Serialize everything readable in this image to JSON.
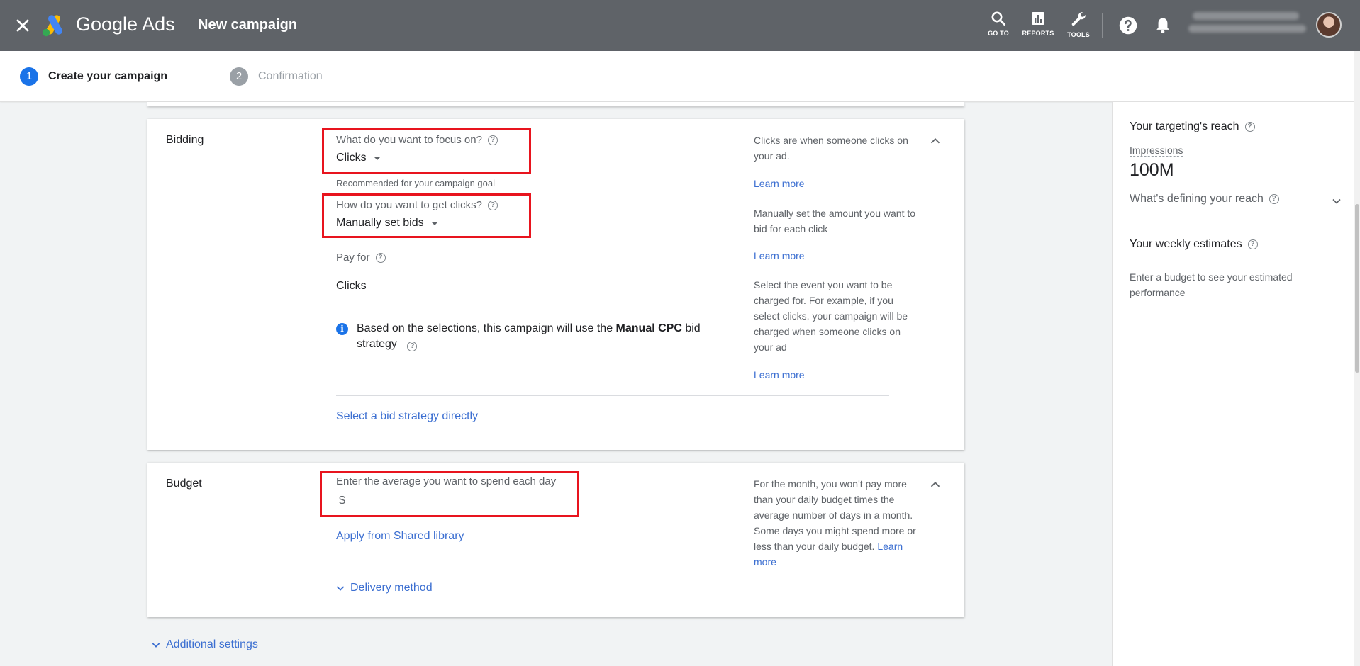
{
  "header": {
    "brand": "Google Ads",
    "title": "New campaign",
    "goto_label": "GO TO",
    "reports_label": "REPORTS",
    "tools_label": "TOOLS"
  },
  "stepper": {
    "steps": [
      {
        "num": "1",
        "label": "Create your campaign",
        "active": true
      },
      {
        "num": "2",
        "label": "Confirmation",
        "active": false
      }
    ]
  },
  "bidding": {
    "section_title": "Bidding",
    "focus_label": "What do you want to focus on?",
    "focus_value": "Clicks",
    "focus_hint": "Recommended for your campaign goal",
    "how_label": "How do you want to get clicks?",
    "how_value": "Manually set bids",
    "payfor_label": "Pay for",
    "payfor_value": "Clicks",
    "info_pre": "Based on the selections, this campaign will use the ",
    "info_bold": "Manual CPC",
    "info_post": " bid",
    "info_line2": "strategy",
    "select_strategy_link": "Select a bid strategy directly",
    "side_1": "Clicks are when someone clicks on your ad.",
    "side_2": "Manually set the amount you want to bid for each click",
    "side_3": "Select the event you want to be charged for. For example, if you select clicks, your campaign will be charged when someone clicks on your ad",
    "learn_more": "Learn more"
  },
  "budget": {
    "section_title": "Budget",
    "field_label": "Enter the average you want to spend each day",
    "currency": "$",
    "apply_link": "Apply from Shared library",
    "delivery_link": "Delivery method",
    "side_text": "For the month, you won't pay more than your daily budget times the average number of days in a month. Some days you might spend more or less than your daily budget.",
    "learn_more": "Learn more"
  },
  "additional_settings": "Additional settings",
  "right_panel": {
    "reach_title": "Your targeting's reach",
    "impressions_label": "Impressions",
    "impressions_value": "100M",
    "defining_label": "What's defining your reach",
    "weekly_title": "Your weekly estimates",
    "weekly_note": "Enter a budget to see your estimated performance"
  },
  "colors": {
    "topbar": "#5f6368",
    "accent_blue": "#1a73e8",
    "link_blue": "#3c6fd1",
    "highlight_red": "#e8141e"
  }
}
